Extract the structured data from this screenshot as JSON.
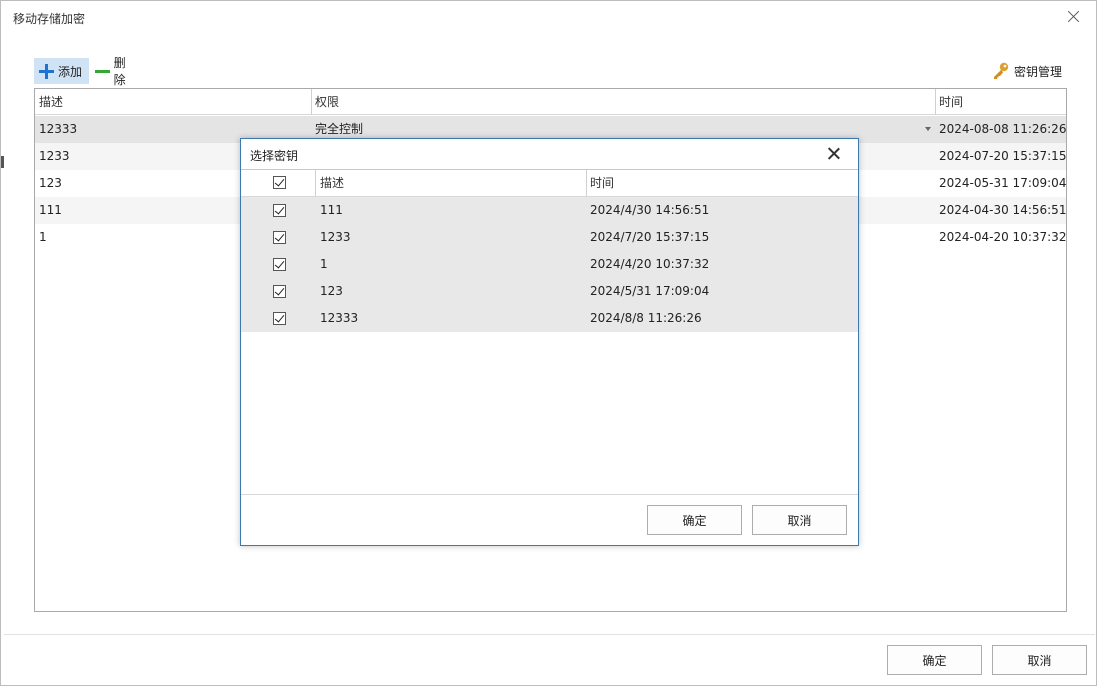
{
  "main": {
    "title": "移动存储加密",
    "toolbar": {
      "add_label": "添加",
      "delete_label": "删除",
      "key_manage_label": "密钥管理"
    },
    "table": {
      "columns": [
        "描述",
        "权限",
        "时间"
      ],
      "rows": [
        {
          "desc": "12333",
          "perm": "完全控制",
          "time": "2024-08-08 11:26:26"
        },
        {
          "desc": "1233",
          "perm": "",
          "time": "2024-07-20 15:37:15"
        },
        {
          "desc": "123",
          "perm": "",
          "time": "2024-05-31 17:09:04"
        },
        {
          "desc": "111",
          "perm": "",
          "time": "2024-04-30 14:56:51"
        },
        {
          "desc": "1",
          "perm": "",
          "time": "2024-04-20 10:37:32"
        }
      ]
    },
    "ok_label": "确定",
    "cancel_label": "取消"
  },
  "dialog": {
    "title": "选择密钥",
    "columns": [
      "描述",
      "时间"
    ],
    "header_checked": true,
    "rows": [
      {
        "checked": true,
        "desc": "111",
        "time": "2024/4/30 14:56:51"
      },
      {
        "checked": true,
        "desc": "1233",
        "time": "2024/7/20 15:37:15"
      },
      {
        "checked": true,
        "desc": "1",
        "time": "2024/4/20 10:37:32"
      },
      {
        "checked": true,
        "desc": "123",
        "time": "2024/5/31 17:09:04"
      },
      {
        "checked": true,
        "desc": "12333",
        "time": "2024/8/8 11:26:26"
      }
    ],
    "ok_label": "确定",
    "cancel_label": "取消"
  },
  "colors": {
    "dialog_border": "#3c79b3",
    "add_icon": "#1e73d2",
    "delete_icon": "#35a735",
    "key_icon": "#e0a030",
    "selected_row": "#e4e4e4",
    "toolbar_active": "#cfe3f5"
  },
  "icons": {
    "add": "plus-icon",
    "delete": "minus-icon",
    "key": "key-icon",
    "close": "close-icon",
    "dropdown": "chevron-down-icon",
    "checkbox": "checkbox-icon"
  }
}
